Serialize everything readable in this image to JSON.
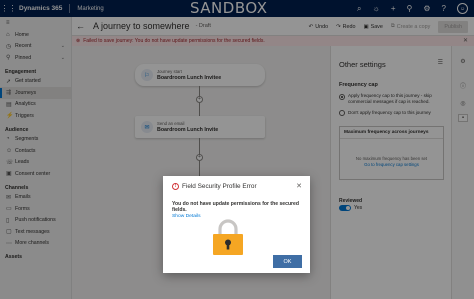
{
  "topbar": {
    "app_name": "Dynamics 365",
    "module": "Marketing",
    "environment": "SANDBOX",
    "icons": [
      "search-icon",
      "lightbulb-icon",
      "plus-icon",
      "filter-icon",
      "gear-icon",
      "help-icon",
      "user-icon"
    ]
  },
  "sidebar": {
    "items_top": [
      {
        "label": "Home",
        "icon": "home-icon"
      },
      {
        "label": "Recent",
        "icon": "clock-icon",
        "chevron": true
      },
      {
        "label": "Pinned",
        "icon": "pin-icon",
        "chevron": true
      }
    ],
    "sections": [
      {
        "title": "Engagement",
        "items": [
          {
            "label": "Get started",
            "icon": "rocket-icon"
          },
          {
            "label": "Journeys",
            "icon": "journey-icon",
            "active": true
          },
          {
            "label": "Analytics",
            "icon": "analytics-icon"
          },
          {
            "label": "Triggers",
            "icon": "trigger-icon"
          }
        ]
      },
      {
        "title": "Audience",
        "items": [
          {
            "label": "Segments",
            "icon": "segment-icon"
          },
          {
            "label": "Contacts",
            "icon": "contact-icon"
          },
          {
            "label": "Leads",
            "icon": "lead-icon"
          },
          {
            "label": "Consent center",
            "icon": "consent-icon"
          }
        ]
      },
      {
        "title": "Channels",
        "items": [
          {
            "label": "Emails",
            "icon": "email-icon"
          },
          {
            "label": "Forms",
            "icon": "form-icon"
          },
          {
            "label": "Push notifications",
            "icon": "push-icon"
          },
          {
            "label": "Text messages",
            "icon": "sms-icon"
          },
          {
            "label": "More channels",
            "icon": "more-icon"
          }
        ]
      },
      {
        "title": "Assets",
        "items": []
      }
    ]
  },
  "command": {
    "title": "A journey to somewhere",
    "status": "- Draft",
    "undo": "Undo",
    "redo": "Redo",
    "save": "Save",
    "copy": "Create a copy",
    "publish": "Publish"
  },
  "error_bar": {
    "message": "Failed to save journey: You do not have update permissions for the secured fields."
  },
  "canvas": {
    "start_tile": {
      "subtitle": "Journey start",
      "title": "Boardroom Lunch Invitee"
    },
    "email_tile": {
      "subtitle": "Send an email",
      "title": "Boardroom Lunch Invite"
    }
  },
  "panel": {
    "title": "Other settings",
    "frequency_cap": "Frequency cap",
    "option_apply": "Apply frequency cap to this journey - skip commercial messages if cap is reached.",
    "option_dont": "Don't apply frequency cap to this journey",
    "max_freq_title": "Maximum frequency across journeys",
    "max_freq_empty": "No maximum frequency has been set",
    "max_freq_link": "Go to frequency cap settings",
    "reviewed_label": "Reviewed",
    "reviewed_value": "Yes"
  },
  "dialog": {
    "title": "Field Security Profile Error",
    "message": "You do not have update permissions for the secured fields.",
    "show_details": "Show Details",
    "ok": "OK",
    "lock_icon": "lock-icon",
    "lock_color": "#f5a623"
  }
}
